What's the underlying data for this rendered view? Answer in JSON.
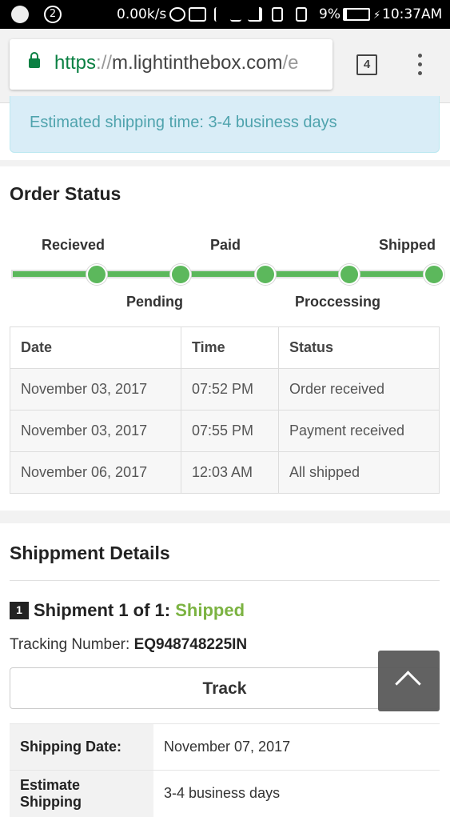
{
  "status_bar": {
    "notification_count": "2",
    "net_speed": "0.00k/s",
    "battery": "9%",
    "battery_level": 0.09,
    "time": "10:37AM"
  },
  "browser": {
    "url_scheme": "https",
    "url_sep": "://",
    "url_host": "m.lightinthebox.com",
    "url_rest": "/e",
    "tab_count": "4"
  },
  "alert": {
    "text": "Estimated shipping time: 3-4 business days"
  },
  "order_status": {
    "title": "Order Status",
    "steps": [
      "Recieved",
      "Pending",
      "Paid",
      "Proccessing",
      "Shipped"
    ],
    "table": {
      "headers": [
        "Date",
        "Time",
        "Status"
      ],
      "rows": [
        [
          "November 03, 2017",
          "07:52 PM",
          "Order received"
        ],
        [
          "November 03, 2017",
          "07:55 PM",
          "Payment received"
        ],
        [
          "November 06, 2017",
          "12:03 AM",
          "All shipped"
        ]
      ]
    }
  },
  "shipment": {
    "section_title": "Shippment Details",
    "badge": "1",
    "title_prefix": "Shipment 1 of 1:",
    "status": "Shipped",
    "tracking_label": "Tracking Number:",
    "tracking_number": "EQ948748225IN",
    "track_button": "Track",
    "details": [
      {
        "label": "Shipping Date:",
        "value": "November 07, 2017"
      },
      {
        "label": "Estimate Shipping",
        "value": "3-4 business days"
      }
    ]
  },
  "colors": {
    "progress": "#5cb85c",
    "shipped_status": "#7cb342",
    "alert_bg": "#d9edf7"
  }
}
